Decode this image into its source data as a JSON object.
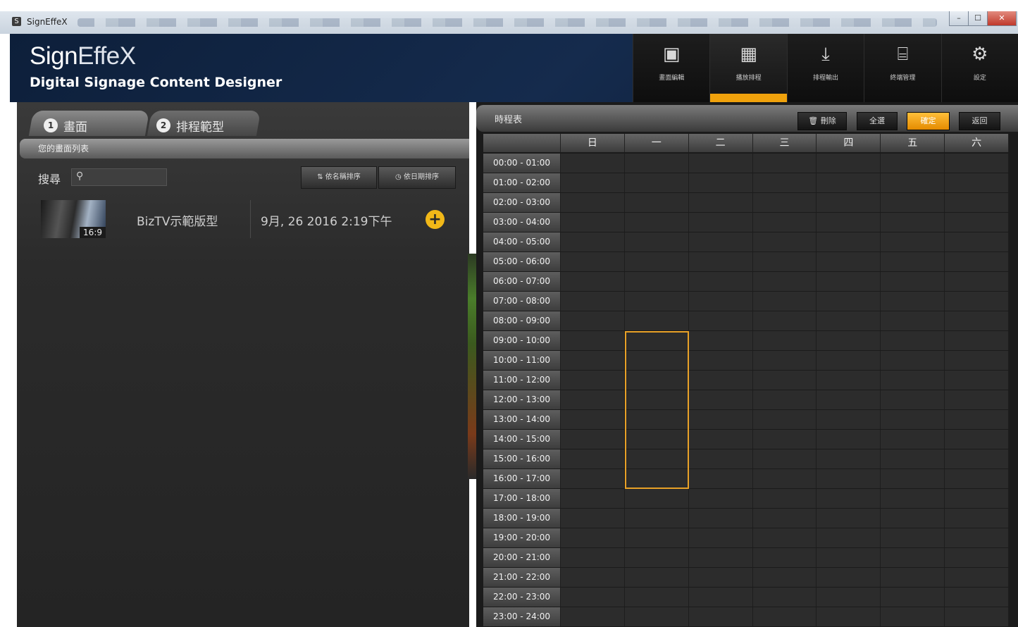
{
  "window": {
    "title": "SignEffeX"
  },
  "brand": {
    "name_bold": "Sign",
    "name_light": "EffeX",
    "subtitle": "Digital Signage Content Designer"
  },
  "nav": [
    {
      "label": "畫面編輯",
      "icon": "image-icon"
    },
    {
      "label": "播放排程",
      "icon": "calendar-icon",
      "active": true
    },
    {
      "label": "排程輸出",
      "icon": "download-icon"
    },
    {
      "label": "終端管理",
      "icon": "router-icon"
    },
    {
      "label": "設定",
      "icon": "gear-icon"
    }
  ],
  "left": {
    "tabs": [
      {
        "num": "1",
        "label": "畫面"
      },
      {
        "num": "2",
        "label": "排程範型"
      }
    ],
    "list_header": "您的畫面列表",
    "search_label": "搜尋",
    "search_placeholder": "",
    "sort_name": "依名稱排序",
    "sort_date": "依日期排序",
    "items": [
      {
        "name": "BizTV示範版型",
        "date": "9月, 26 2016 2:19下午",
        "ratio": "16:9"
      }
    ]
  },
  "schedule": {
    "title": "時程表",
    "buttons": {
      "delete": "刪除",
      "all": "全選",
      "apply": "確定",
      "back": "返回"
    },
    "days": [
      "日",
      "一",
      "二",
      "三",
      "四",
      "五",
      "六"
    ],
    "times": [
      "00:00 - 01:00",
      "01:00 - 02:00",
      "02:00 - 03:00",
      "03:00 - 04:00",
      "04:00 - 05:00",
      "05:00 - 06:00",
      "06:00 - 07:00",
      "07:00 - 08:00",
      "08:00 - 09:00",
      "09:00 - 10:00",
      "10:00 - 11:00",
      "11:00 - 12:00",
      "12:00 - 13:00",
      "13:00 - 14:00",
      "14:00 - 15:00",
      "15:00 - 16:00",
      "16:00 - 17:00",
      "17:00 - 18:00",
      "18:00 - 19:00",
      "19:00 - 20:00",
      "20:00 - 21:00",
      "21:00 - 22:00",
      "22:00 - 23:00",
      "23:00 - 24:00"
    ],
    "selection": {
      "day": "一",
      "from": "09:00",
      "to": "17:00",
      "color": "#e8a127"
    }
  },
  "colors": {
    "accent": "#f0a20c",
    "header_bg": "#0d1f3a"
  }
}
